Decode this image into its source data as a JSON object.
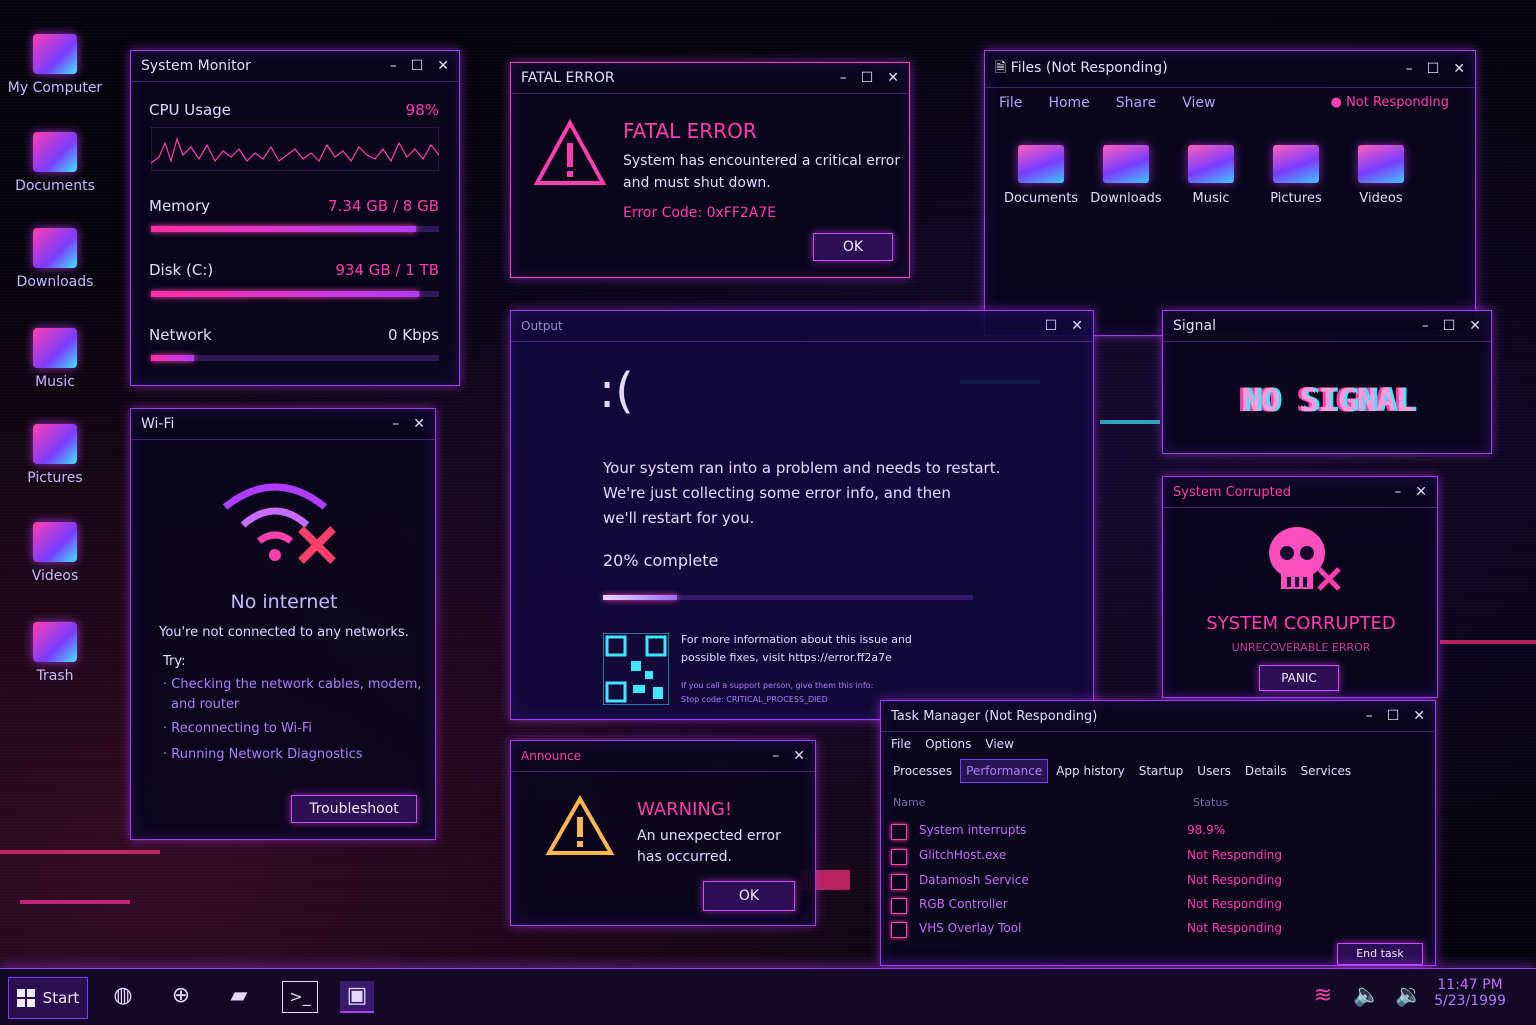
{
  "desktop_icons": [
    {
      "label": "My Computer",
      "icon": "computer-icon"
    },
    {
      "label": "Documents",
      "icon": "folder-icon"
    },
    {
      "label": "Downloads",
      "icon": "folder-icon"
    },
    {
      "label": "Music",
      "icon": "music-note-icon"
    },
    {
      "label": "Pictures",
      "icon": "image-folder-icon"
    },
    {
      "label": "Videos",
      "icon": "video-folder-icon"
    },
    {
      "label": "Trash",
      "icon": "trash-icon"
    }
  ],
  "system_monitor": {
    "title": "System Monitor",
    "cpu_label": "CPU Usage",
    "cpu_value": "98%",
    "memory_label": "Memory",
    "memory_value": "7.34 GB / 8 GB",
    "memory_fraction": 0.92,
    "disk_label": "Disk (C:)",
    "disk_value": "934 GB / 1 TB",
    "disk_fraction": 0.93,
    "network_label": "Network",
    "network_value": "0 Kbps",
    "network_fraction": 0.15
  },
  "fatal_error": {
    "title": "FATAL ERROR",
    "heading": "FATAL ERROR",
    "message_line1": "System has encountered a critical error",
    "message_line2": "and must shut down.",
    "code_label": "Error Code:",
    "code_value": "0xFF2A7E",
    "ok_label": "OK"
  },
  "files": {
    "title": "Files (Not Responding)",
    "menu": [
      "File",
      "Home",
      "Share",
      "View"
    ],
    "status": "Not Responding",
    "folders": [
      "Documents",
      "Downloads",
      "Music",
      "Pictures",
      "Videos"
    ]
  },
  "wifi": {
    "title": "Wi-Fi",
    "heading": "No internet",
    "subheading": "You're not connected to any networks.",
    "try_label": "Try:",
    "tips": [
      "Checking the network cables, modem,",
      "and router",
      "Reconnecting to Wi-Fi",
      "Running Network Diagnostics"
    ],
    "button_label": "Troubleshoot"
  },
  "bsod": {
    "title": "Output",
    "sad_face": ":(",
    "line1": "Your system ran into a problem and needs to restart.",
    "line2": "We're just collecting some error info, and then",
    "line3": "we'll restart for you.",
    "progress_text": "20% complete",
    "progress_fraction": 0.2,
    "info_line1": "For more information about this issue and",
    "info_line2": "possible fixes, visit https://error.ff2a7e",
    "support_line": "If you call a support person, give them this info:",
    "stop_code": "Stop code: CRITICAL_PROCESS_DIED"
  },
  "signal": {
    "title": "Signal",
    "message": "NO SIGNAL"
  },
  "corrupted": {
    "title": "System Corrupted",
    "heading": "SYSTEM CORRUPTED",
    "subheading": "UNRECOVERABLE ERROR",
    "button_label": "PANIC"
  },
  "warning": {
    "title": "Announce",
    "heading": "WARNING!",
    "line1": "An unexpected error",
    "line2": "has occurred.",
    "ok_label": "OK"
  },
  "task_manager": {
    "title": "Task Manager (Not Responding)",
    "menu": [
      "File",
      "Options",
      "View"
    ],
    "tabs": [
      "Processes",
      "Performance",
      "App history",
      "Startup",
      "Users",
      "Details",
      "Services"
    ],
    "col_name": "Name",
    "col_status": "Status",
    "rows": [
      {
        "name": "System interrupts",
        "status": "98.9%"
      },
      {
        "name": "GlitchHost.exe",
        "status": "Not Responding"
      },
      {
        "name": "Datamosh Service",
        "status": "Not Responding"
      },
      {
        "name": "RGB Controller",
        "status": "Not Responding"
      },
      {
        "name": "VHS Overlay Tool",
        "status": "Not Responding"
      }
    ],
    "end_task_label": "End task"
  },
  "taskbar": {
    "start_label": "Start",
    "time": "11:47 PM",
    "date": "5/23/1999"
  },
  "colors": {
    "accent_pink": "#ff3fae",
    "accent_purple": "#a23bff",
    "accent_cyan": "#3fe6ff",
    "background": "#05030d"
  }
}
